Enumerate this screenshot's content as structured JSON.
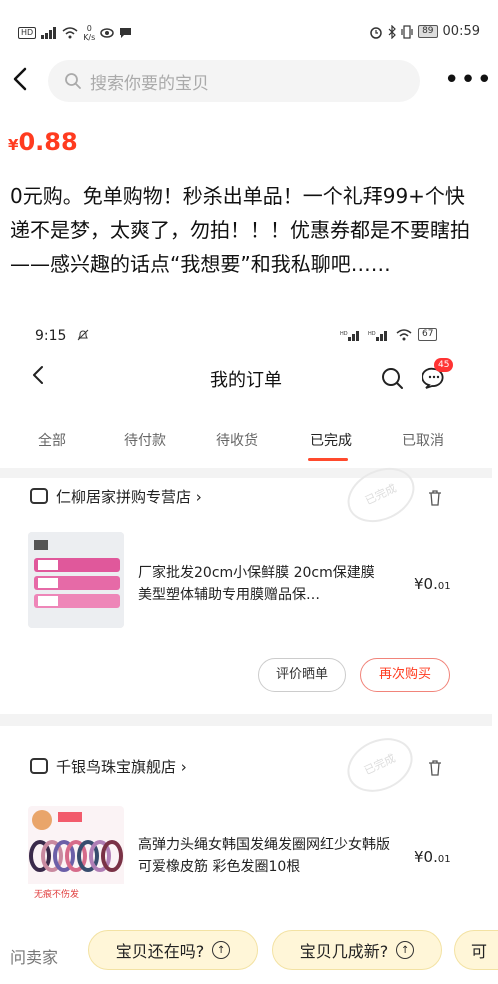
{
  "status_bar": {
    "left_icons": [
      "hd-icon",
      "signal-icon",
      "wifi-icon",
      "speed-icon",
      "eye-icon",
      "chat-icon"
    ],
    "speed_top": "0",
    "speed_unit": "K/s",
    "battery": "89",
    "time": "00:59"
  },
  "search": {
    "placeholder": "搜索你要的宝贝"
  },
  "product": {
    "price_currency": "¥",
    "price_value": "0.88",
    "description": "0元购。免单购物！秒杀出单品！一个礼拜99+个快递不是梦，太爽了，勿拍！！！优惠券都是不要瞎拍——感兴趣的话点“我想要”和我私聊吧……"
  },
  "inner": {
    "status_time": "9:15",
    "battery": "67",
    "title": "我的订单",
    "chat_badge": "45",
    "tabs": [
      "全部",
      "待付款",
      "待收货",
      "已完成",
      "已取消"
    ],
    "active_tab": "已完成",
    "orders": [
      {
        "shop": "仁柳居家拼购专营店 ›",
        "stamp": "已完成",
        "title": "厂家批发20cm小保鲜膜 20cm保建膜美型塑体辅助专用膜赠品保…",
        "price_main": "¥0.",
        "price_dec": "01",
        "buttons": [
          "评价晒单",
          "再次购买"
        ]
      },
      {
        "shop": "千银鸟珠宝旗舰店 ›",
        "stamp": "已完成",
        "title": "高弹力头绳女韩国发绳发圈网红少女韩版可爱橡皮筋 彩色发圈10根",
        "price_main": "¥0.",
        "price_dec": "01",
        "thumb_caption": "无痕不伤发"
      }
    ]
  },
  "quick_bar": {
    "label": "问卖家",
    "chips": [
      "宝贝还在吗?",
      "宝贝几成新?",
      "可"
    ]
  }
}
